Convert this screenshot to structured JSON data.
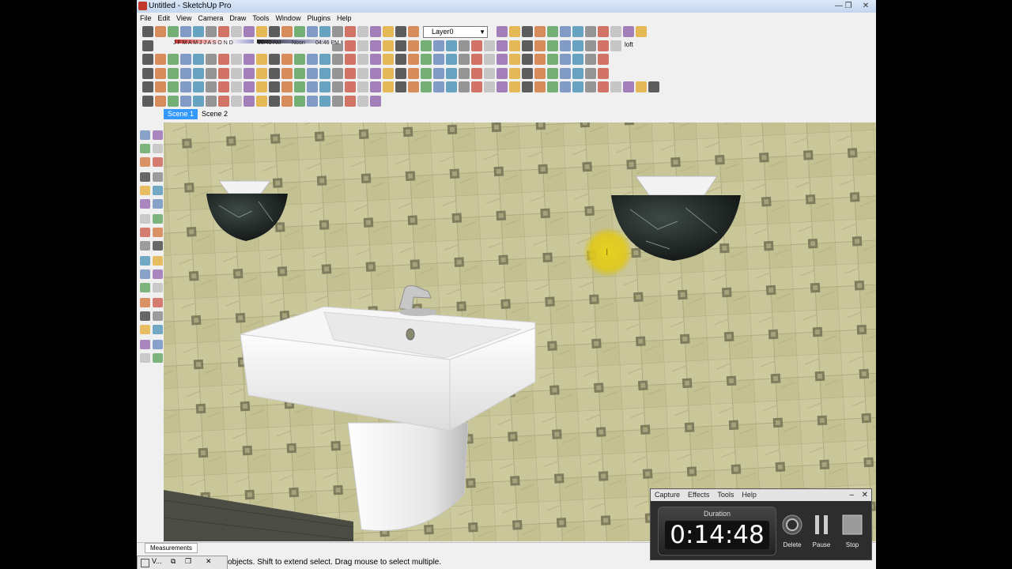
{
  "window": {
    "title": "Untitled - SketchUp Pro",
    "controls": [
      "—",
      "❐",
      "✕"
    ]
  },
  "menu": [
    "File",
    "Edit",
    "View",
    "Camera",
    "Draw",
    "Tools",
    "Window",
    "Plugins",
    "Help"
  ],
  "toolbar": {
    "layer_select": "Layer0",
    "shadow_months": "J F M A M J J A S O N D",
    "shadow_time_start": "06:43 AM",
    "shadow_time_mid": "Noon",
    "shadow_time_end": "04:46 PM",
    "extra_label": "loft"
  },
  "scenes": [
    "Scene 1",
    "Scene 2"
  ],
  "status": {
    "measurements_label": "Measurements",
    "message": "objects. Shift to extend select. Drag mouse to select multiple.",
    "mini_task_label": "V..."
  },
  "recorder": {
    "menu": [
      "Capture",
      "Effects",
      "Tools",
      "Help"
    ],
    "duration_label": "Duration",
    "time": "0:14:48",
    "buttons": {
      "delete": "Delete",
      "pause": "Pause",
      "stop": "Stop"
    }
  },
  "colors": {
    "tile_base": "#c9c69a",
    "tile_dark": "#8d8a68",
    "active_tab": "#3399ff",
    "cursor_highlight": "#e6d21e"
  }
}
